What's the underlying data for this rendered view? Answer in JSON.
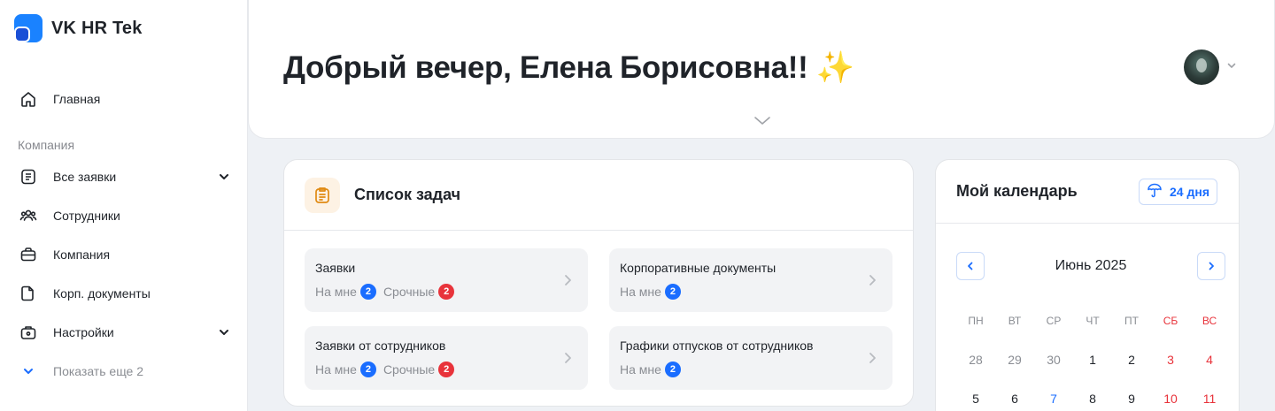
{
  "app": {
    "name": "VK HR Tek"
  },
  "sidebar": {
    "home": "Главная",
    "section": "Компания",
    "items": [
      {
        "label": "Все заявки",
        "icon": "list-icon",
        "expandable": true
      },
      {
        "label": "Сотрудники",
        "icon": "users-icon",
        "expandable": false
      },
      {
        "label": "Компания",
        "icon": "briefcase-icon",
        "expandable": false
      },
      {
        "label": "Корп. документы",
        "icon": "document-icon",
        "expandable": false
      },
      {
        "label": "Настройки",
        "icon": "toolbox-icon",
        "expandable": true
      }
    ],
    "show_more": "Показать еще 2"
  },
  "header": {
    "greeting": "Добрый вечер, Елена Борисовна!! ✨"
  },
  "tasks": {
    "title": "Список задач",
    "cards": [
      {
        "title": "Заявки",
        "mine_label": "На мне",
        "mine_count": "2",
        "urgent_label": "Срочные",
        "urgent_count": "2"
      },
      {
        "title": "Корпоративные документы",
        "mine_label": "На мне",
        "mine_count": "2"
      },
      {
        "title": "Заявки от сотрудников",
        "mine_label": "На мне",
        "mine_count": "2",
        "urgent_label": "Срочные",
        "urgent_count": "2"
      },
      {
        "title": "Графики отпусков от сотрудников",
        "mine_label": "На мне",
        "mine_count": "2"
      }
    ]
  },
  "calendar": {
    "title": "Мой календарь",
    "vacation_days": "24 дня",
    "month": "Июнь 2025",
    "weekdays": [
      "ПН",
      "ВТ",
      "СР",
      "ЧТ",
      "ПТ",
      "СБ",
      "ВС"
    ],
    "weeks": [
      [
        "28",
        "29",
        "30",
        "1",
        "2",
        "3",
        "4"
      ],
      [
        "5",
        "6",
        "7",
        "8",
        "9",
        "10",
        "11"
      ]
    ]
  },
  "colors": {
    "accent": "#1a6dff",
    "weekend": "#e8333b",
    "badge_urgent": "#e8333b"
  }
}
